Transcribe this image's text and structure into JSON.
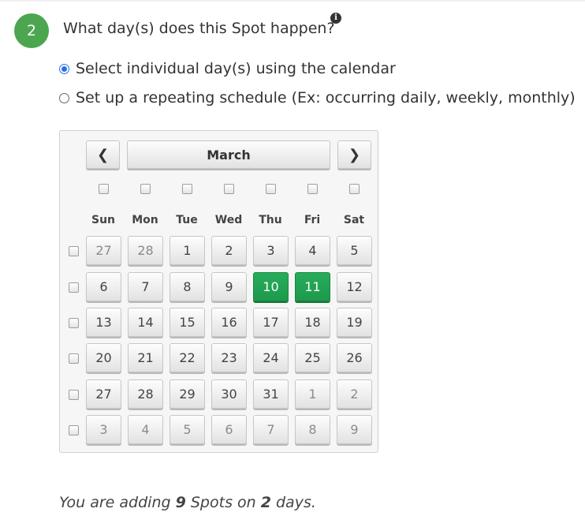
{
  "step": {
    "number": "2",
    "question": "What day(s) does this Spot happen?",
    "info_icon": "info-icon"
  },
  "options": [
    {
      "label": "Select individual day(s) using the calendar",
      "checked": true
    },
    {
      "label": "Set up a repeating schedule (Ex: occurring daily, weekly, monthly)",
      "checked": false
    }
  ],
  "calendar": {
    "month": "March",
    "prev_icon": "chevron-left-icon",
    "next_icon": "chevron-right-icon",
    "weekdays": [
      "Sun",
      "Mon",
      "Tue",
      "Wed",
      "Thu",
      "Fri",
      "Sat"
    ],
    "weeks": [
      [
        {
          "d": "27",
          "muted": true
        },
        {
          "d": "28",
          "muted": true
        },
        {
          "d": "1"
        },
        {
          "d": "2"
        },
        {
          "d": "3"
        },
        {
          "d": "4"
        },
        {
          "d": "5"
        }
      ],
      [
        {
          "d": "6"
        },
        {
          "d": "7"
        },
        {
          "d": "8"
        },
        {
          "d": "9"
        },
        {
          "d": "10",
          "selected": true
        },
        {
          "d": "11",
          "selected": true
        },
        {
          "d": "12"
        }
      ],
      [
        {
          "d": "13"
        },
        {
          "d": "14"
        },
        {
          "d": "15"
        },
        {
          "d": "16"
        },
        {
          "d": "17"
        },
        {
          "d": "18"
        },
        {
          "d": "19"
        }
      ],
      [
        {
          "d": "20"
        },
        {
          "d": "21"
        },
        {
          "d": "22"
        },
        {
          "d": "23"
        },
        {
          "d": "24"
        },
        {
          "d": "25"
        },
        {
          "d": "26"
        }
      ],
      [
        {
          "d": "27"
        },
        {
          "d": "28"
        },
        {
          "d": "29"
        },
        {
          "d": "30"
        },
        {
          "d": "31"
        },
        {
          "d": "1",
          "muted": true
        },
        {
          "d": "2",
          "muted": true
        }
      ],
      [
        {
          "d": "3",
          "muted": true
        },
        {
          "d": "4",
          "muted": true
        },
        {
          "d": "5",
          "muted": true
        },
        {
          "d": "6",
          "muted": true
        },
        {
          "d": "7",
          "muted": true
        },
        {
          "d": "8",
          "muted": true
        },
        {
          "d": "9",
          "muted": true
        }
      ]
    ],
    "selected_color": "#1fa352"
  },
  "summary": {
    "prefix": "You are adding ",
    "spots_count": "9",
    "middle": " Spots on ",
    "days_count": "2",
    "suffix": " days."
  }
}
